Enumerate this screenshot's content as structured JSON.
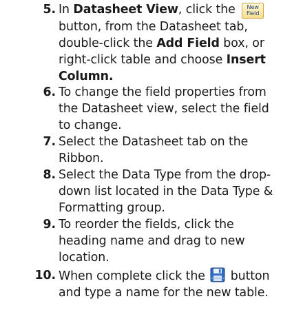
{
  "steps": [
    {
      "number": "5.",
      "lines": [
        [
          "In ",
          {
            "b": "Datasheet View"
          },
          ", click the "
        ],
        [
          "button, from the Datasheet tab,"
        ],
        [
          "double-click the ",
          {
            "b": "Add Field"
          },
          " box, or"
        ],
        [
          "right-click table and choose ",
          {
            "b": "Insert"
          }
        ],
        [
          {
            "b": "Column."
          }
        ]
      ]
    },
    {
      "number": "6.",
      "lines": [
        [
          "To change the field properties from"
        ],
        [
          "the Datasheet view, select the field"
        ],
        [
          "to change."
        ]
      ]
    },
    {
      "number": "7.",
      "lines": [
        [
          "Select the Datasheet tab on the"
        ],
        [
          "Ribbon."
        ]
      ]
    },
    {
      "number": "8.",
      "lines": [
        [
          "Select the Data Type from the drop-"
        ],
        [
          "down list located in the Data Type &"
        ],
        [
          "Formatting group."
        ]
      ]
    },
    {
      "number": "9.",
      "lines": [
        [
          "To reorder the fields, click the"
        ],
        [
          "heading name and drag to new"
        ],
        [
          "location."
        ]
      ]
    },
    {
      "number": "10.",
      "lines": [
        [
          "When complete click the ",
          {
            "icon": "save-icon"
          },
          " button"
        ],
        [
          "and type a name for the new table."
        ]
      ]
    }
  ],
  "icons": {
    "new_field": {
      "name": "new-field-icon",
      "line1": "New",
      "line2": "Field"
    },
    "save": {
      "name": "save-icon"
    }
  },
  "colors": {
    "text": "#1a1a1a",
    "icon_blue": "#1d3f7a",
    "icon_gold": "#d4a84a"
  }
}
